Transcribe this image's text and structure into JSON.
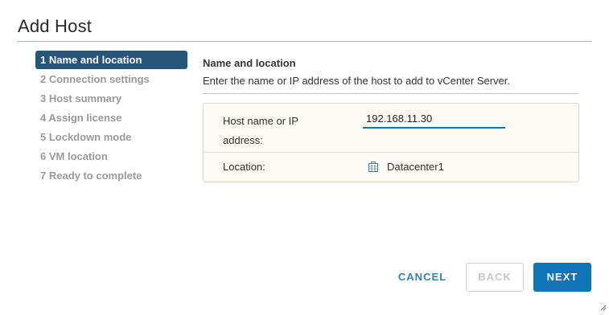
{
  "dialog": {
    "title": "Add Host"
  },
  "steps": [
    {
      "label": "1 Name and location",
      "active": true
    },
    {
      "label": "2 Connection settings",
      "active": false
    },
    {
      "label": "3 Host summary",
      "active": false
    },
    {
      "label": "4 Assign license",
      "active": false
    },
    {
      "label": "5 Lockdown mode",
      "active": false
    },
    {
      "label": "6 VM location",
      "active": false
    },
    {
      "label": "7 Ready to complete",
      "active": false
    }
  ],
  "section": {
    "title": "Name and location",
    "description": "Enter the name or IP address of the host to add to vCenter Server."
  },
  "form": {
    "host_label": "Host name or IP address:",
    "host_value": "192.168.11.30",
    "location_label": "Location:",
    "location_value": "Datacenter1",
    "location_icon": "datacenter-icon"
  },
  "buttons": {
    "cancel": "CANCEL",
    "back": "BACK",
    "next": "NEXT"
  },
  "colors": {
    "active_step_bg": "#27557c",
    "primary_button": "#0f74b8",
    "link_text": "#2f82bf",
    "input_underline": "#1a73b9",
    "form_bg": "#fcfbf3"
  }
}
